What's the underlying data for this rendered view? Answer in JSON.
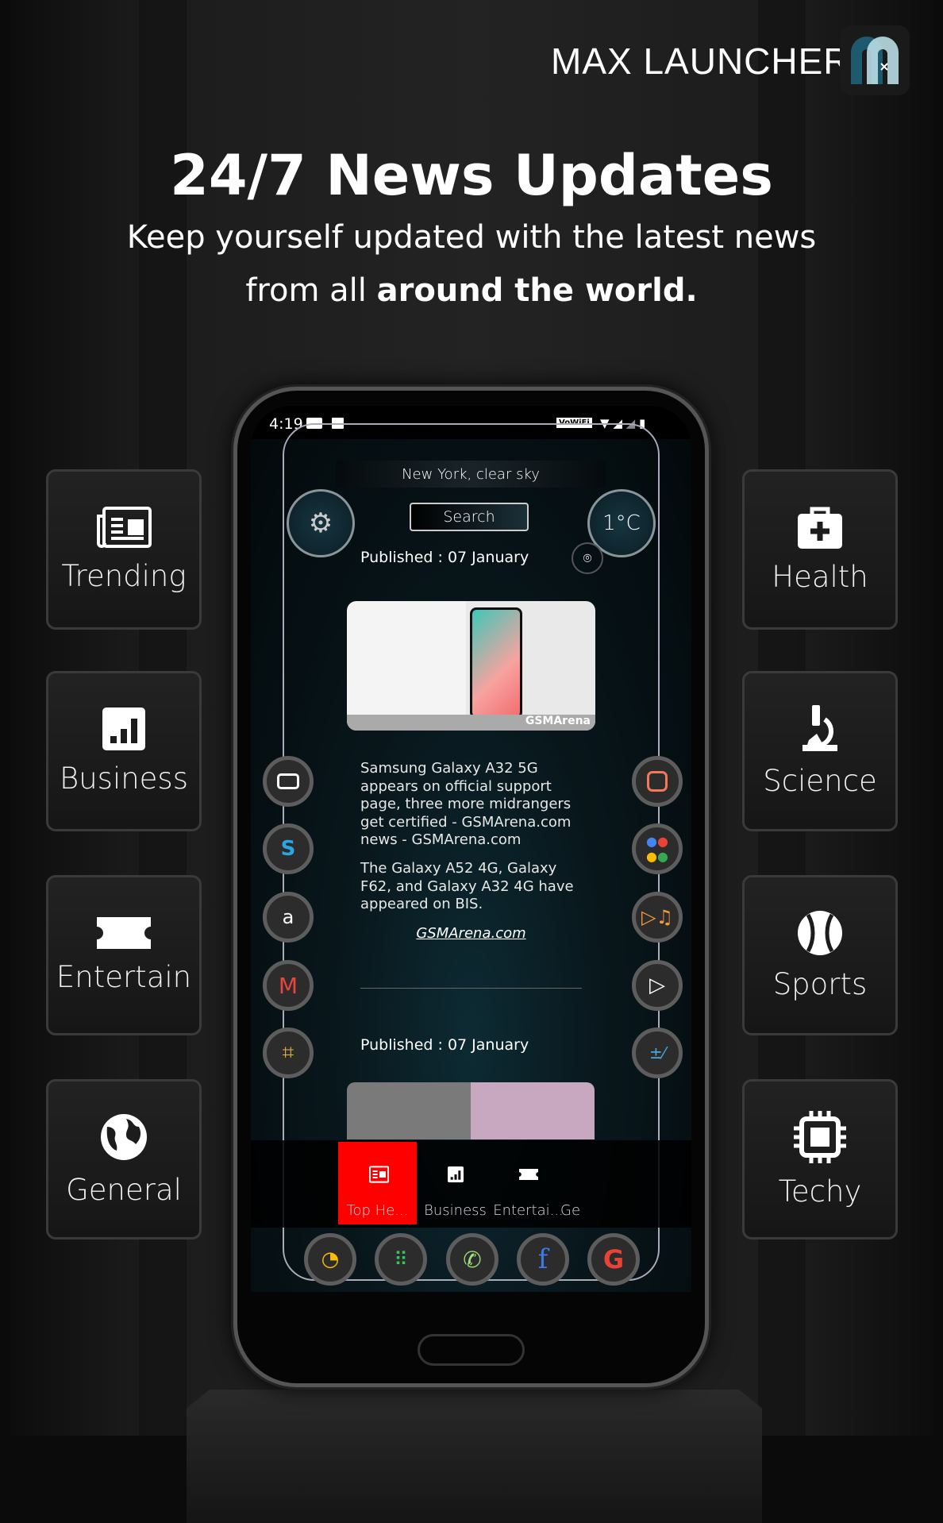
{
  "brand": {
    "name": "MAX LAUNCHER",
    "logo_text": "M"
  },
  "hero": {
    "title": "24/7 News Updates",
    "subtitle_line1": "Keep yourself updated with the latest news",
    "subtitle_line2_prefix": "from all ",
    "subtitle_line2_bold": "around the world."
  },
  "left_tiles": [
    {
      "label": "Trending",
      "icon": "newspaper-icon"
    },
    {
      "label": "Business",
      "icon": "bar-chart-icon"
    },
    {
      "label": "Entertain",
      "icon": "ticket-icon"
    },
    {
      "label": "General",
      "icon": "globe-icon"
    }
  ],
  "right_tiles": [
    {
      "label": "Health",
      "icon": "medical-kit-icon"
    },
    {
      "label": "Science",
      "icon": "microscope-icon"
    },
    {
      "label": "Sports",
      "icon": "baseball-icon"
    },
    {
      "label": "Techy",
      "icon": "chip-icon"
    }
  ],
  "phone": {
    "status": {
      "time": "4:19",
      "wifi_badge": "VoWiFi"
    },
    "weather": "New York, clear sky",
    "search_label": "Search",
    "temperature": "1°C",
    "articles": [
      {
        "published": "Published : 07 January",
        "headline": "Samsung Galaxy A32 5G appears on official support page, three more midrangers get certified - GSMArena.com news - GSMArena.com",
        "summary": "The Galaxy A52 4G, Galaxy F62, and Galaxy A32 4G have appeared on BIS.",
        "source": "GSMArena.com",
        "image_watermark": "GSMArena"
      },
      {
        "published": "Published : 07 January"
      }
    ],
    "tabs": [
      {
        "label": "Top He...",
        "icon": "newspaper-icon",
        "active": true
      },
      {
        "label": "Business",
        "icon": "bar-chart-icon"
      },
      {
        "label": "Entertai...",
        "icon": "ticket-icon"
      },
      {
        "label": "Ge",
        "icon": "globe-icon"
      }
    ],
    "left_apps": [
      "camera-icon",
      "shazam-icon",
      "amazon-icon",
      "gmail-icon",
      "chip-app-icon"
    ],
    "right_apps": [
      "instagram-icon",
      "assistant-icon",
      "music-icon",
      "play-store-icon",
      "calculator-icon"
    ],
    "dock": [
      "google-maps-icon",
      "phone-dialer-icon",
      "whatsapp-icon",
      "facebook-icon",
      "google-icon"
    ]
  },
  "colors": {
    "accent_red": "#ff0000",
    "background": "#1e1e1e",
    "logo_blue": "#1d5a6e"
  }
}
